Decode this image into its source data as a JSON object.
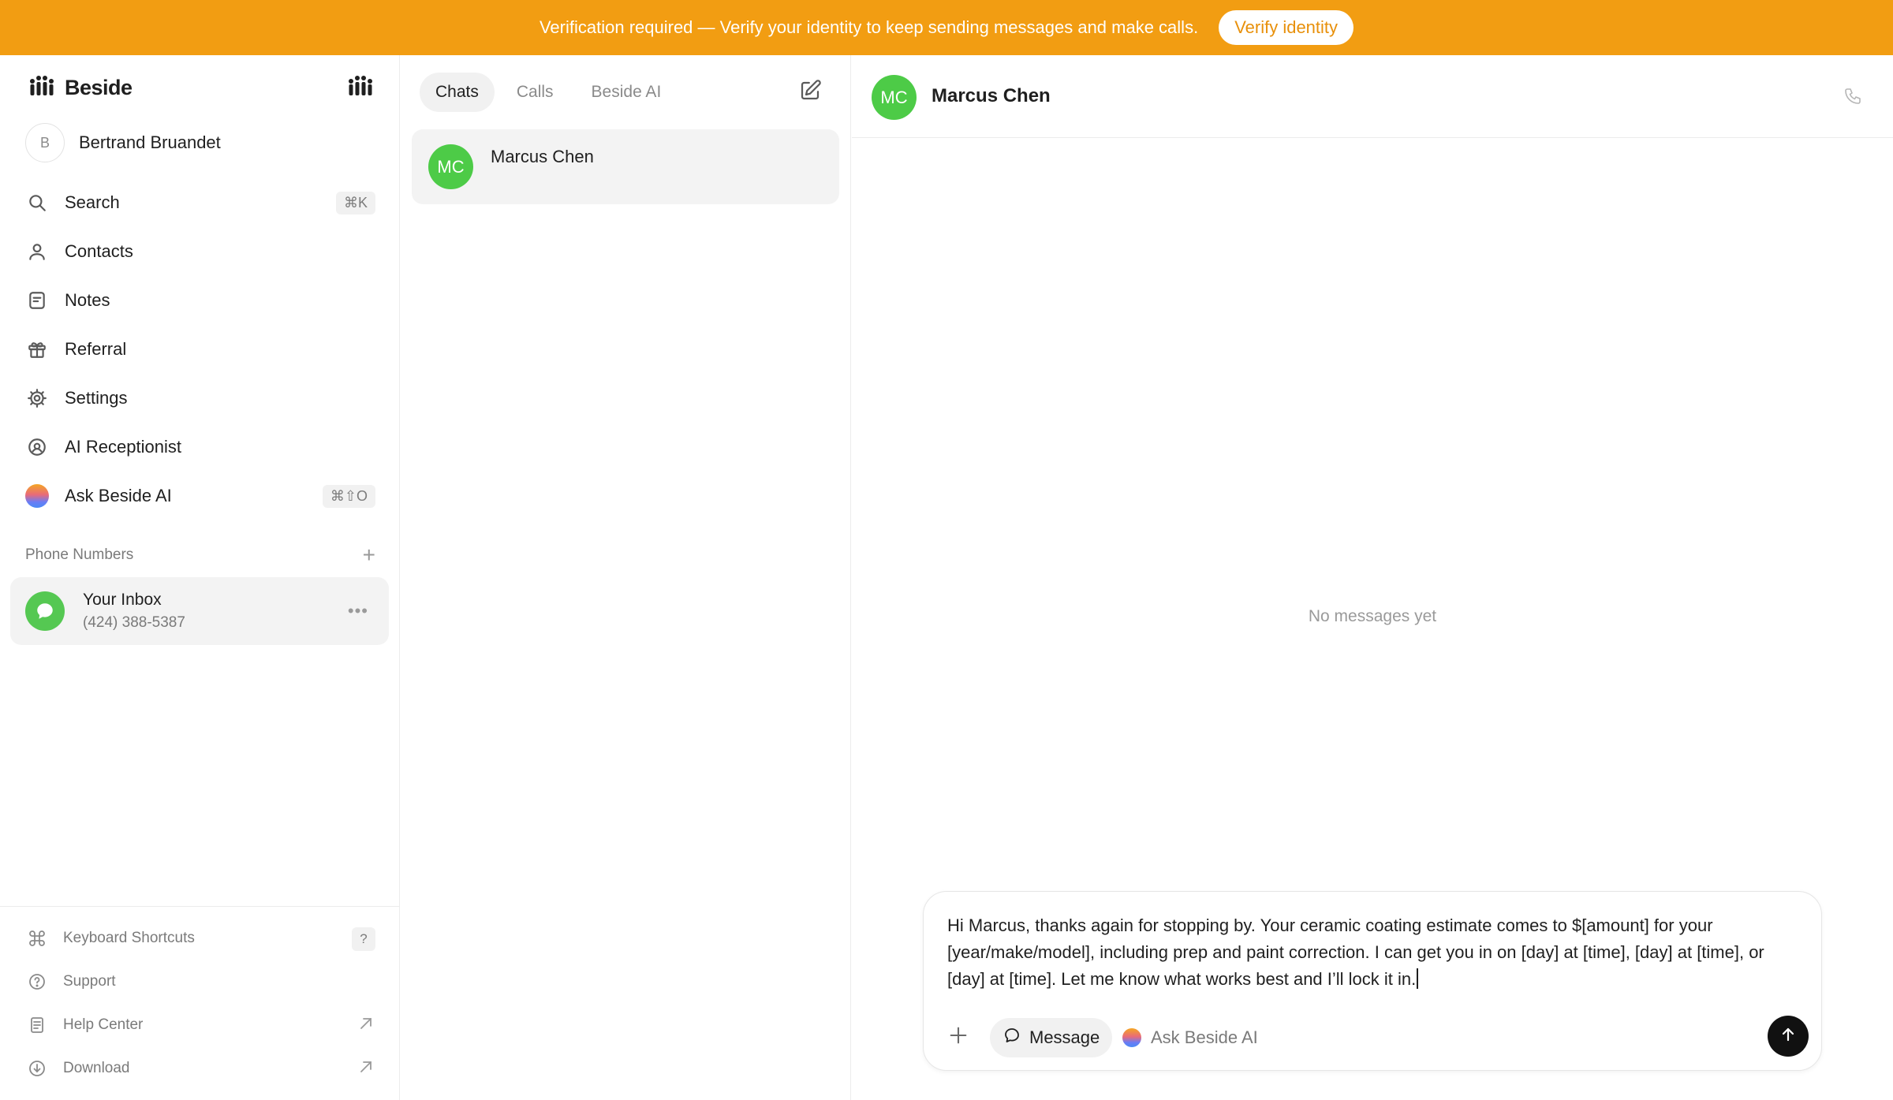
{
  "banner": {
    "text": "Verification required — Verify your identity to keep sending messages and make calls.",
    "button_label": "Verify identity",
    "color": "#f29d12"
  },
  "sidebar": {
    "brand": "Beside",
    "user": {
      "initial": "B",
      "name": "Bertrand Bruandet"
    },
    "nav": [
      {
        "label": "Search",
        "icon": "search-icon",
        "shortcut": "⌘K"
      },
      {
        "label": "Contacts",
        "icon": "person-icon"
      },
      {
        "label": "Notes",
        "icon": "notes-icon"
      },
      {
        "label": "Referral",
        "icon": "gift-icon"
      },
      {
        "label": "Settings",
        "icon": "gear-icon"
      },
      {
        "label": "AI Receptionist",
        "icon": "receptionist-icon"
      },
      {
        "label": "Ask Beside AI",
        "icon": "ai-orb-icon",
        "shortcut": "⌘⇧O"
      }
    ],
    "phone_numbers_label": "Phone Numbers",
    "inbox": {
      "name": "Your Inbox",
      "phone": "(424) 388-5387"
    },
    "footer": [
      {
        "label": "Keyboard Shortcuts",
        "icon": "command-icon",
        "badge": "?"
      },
      {
        "label": "Support",
        "icon": "question-icon"
      },
      {
        "label": "Help Center",
        "icon": "document-icon"
      },
      {
        "label": "Download",
        "icon": "download-icon"
      }
    ]
  },
  "chatlist": {
    "tabs": [
      "Chats",
      "Calls",
      "Beside AI"
    ],
    "active_tab": "Chats",
    "items": [
      {
        "initials": "MC",
        "name": "Marcus Chen"
      }
    ]
  },
  "conversation": {
    "contact_initials": "MC",
    "contact_name": "Marcus Chen",
    "avatar_color": "#4dcb47",
    "empty_text": "No messages yet",
    "draft": "Hi Marcus, thanks again for stopping by. Your ceramic coating estimate comes to $[amount] for your [year/make/model], including prep and paint correction. I can get you in on [day] at [time], [day] at [time], or [day] at [time]. Let me know what works best and I’ll lock it in.",
    "mode_message": "Message",
    "mode_ai": "Ask Beside AI"
  }
}
